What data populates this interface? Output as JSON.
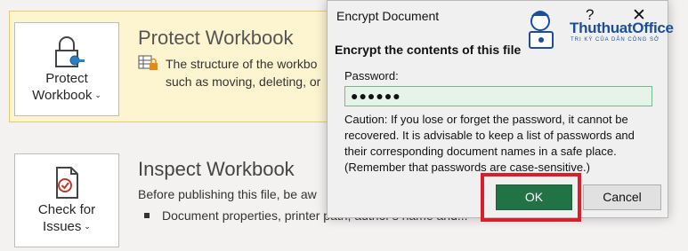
{
  "protect": {
    "tile_line1": "Protect",
    "tile_line2": "Workbook",
    "title": "Protect Workbook",
    "desc_line1": "The structure of the workbo",
    "desc_line2": "such as moving, deleting, or"
  },
  "inspect": {
    "tile_line1": "Check for",
    "tile_line2": "Issues",
    "title": "Inspect Workbook",
    "desc": "Before publishing this file, be aw",
    "bullet": "Document properties, printer path, author's name and..."
  },
  "dialog": {
    "title": "Encrypt Document",
    "help_label": "?",
    "close_label": "✕",
    "heading": "Encrypt the contents of this file",
    "password_label": "Password:",
    "password_value": "●●●●●●",
    "caution": "Caution: If you lose or forget the password, it cannot be recovered. It is advisable to keep a list of passwords and their corresponding document names in a safe place. (Remember that passwords are case-sensitive.)",
    "ok_label": "OK",
    "cancel_label": "Cancel"
  },
  "watermark": {
    "name": "ThuthuatOffice",
    "tagline": "TRI KỲ CỦA DÂN CÔNG SỞ"
  },
  "colors": {
    "accent_green": "#217346",
    "highlight_red": "#d9202a",
    "panel_yellow": "#fdf4d0",
    "logo_blue": "#1b4f9c"
  },
  "icons": [
    "lock-key-icon",
    "structure-lock-icon",
    "document-check-icon",
    "chevron-down-icon",
    "help-icon",
    "close-icon"
  ]
}
